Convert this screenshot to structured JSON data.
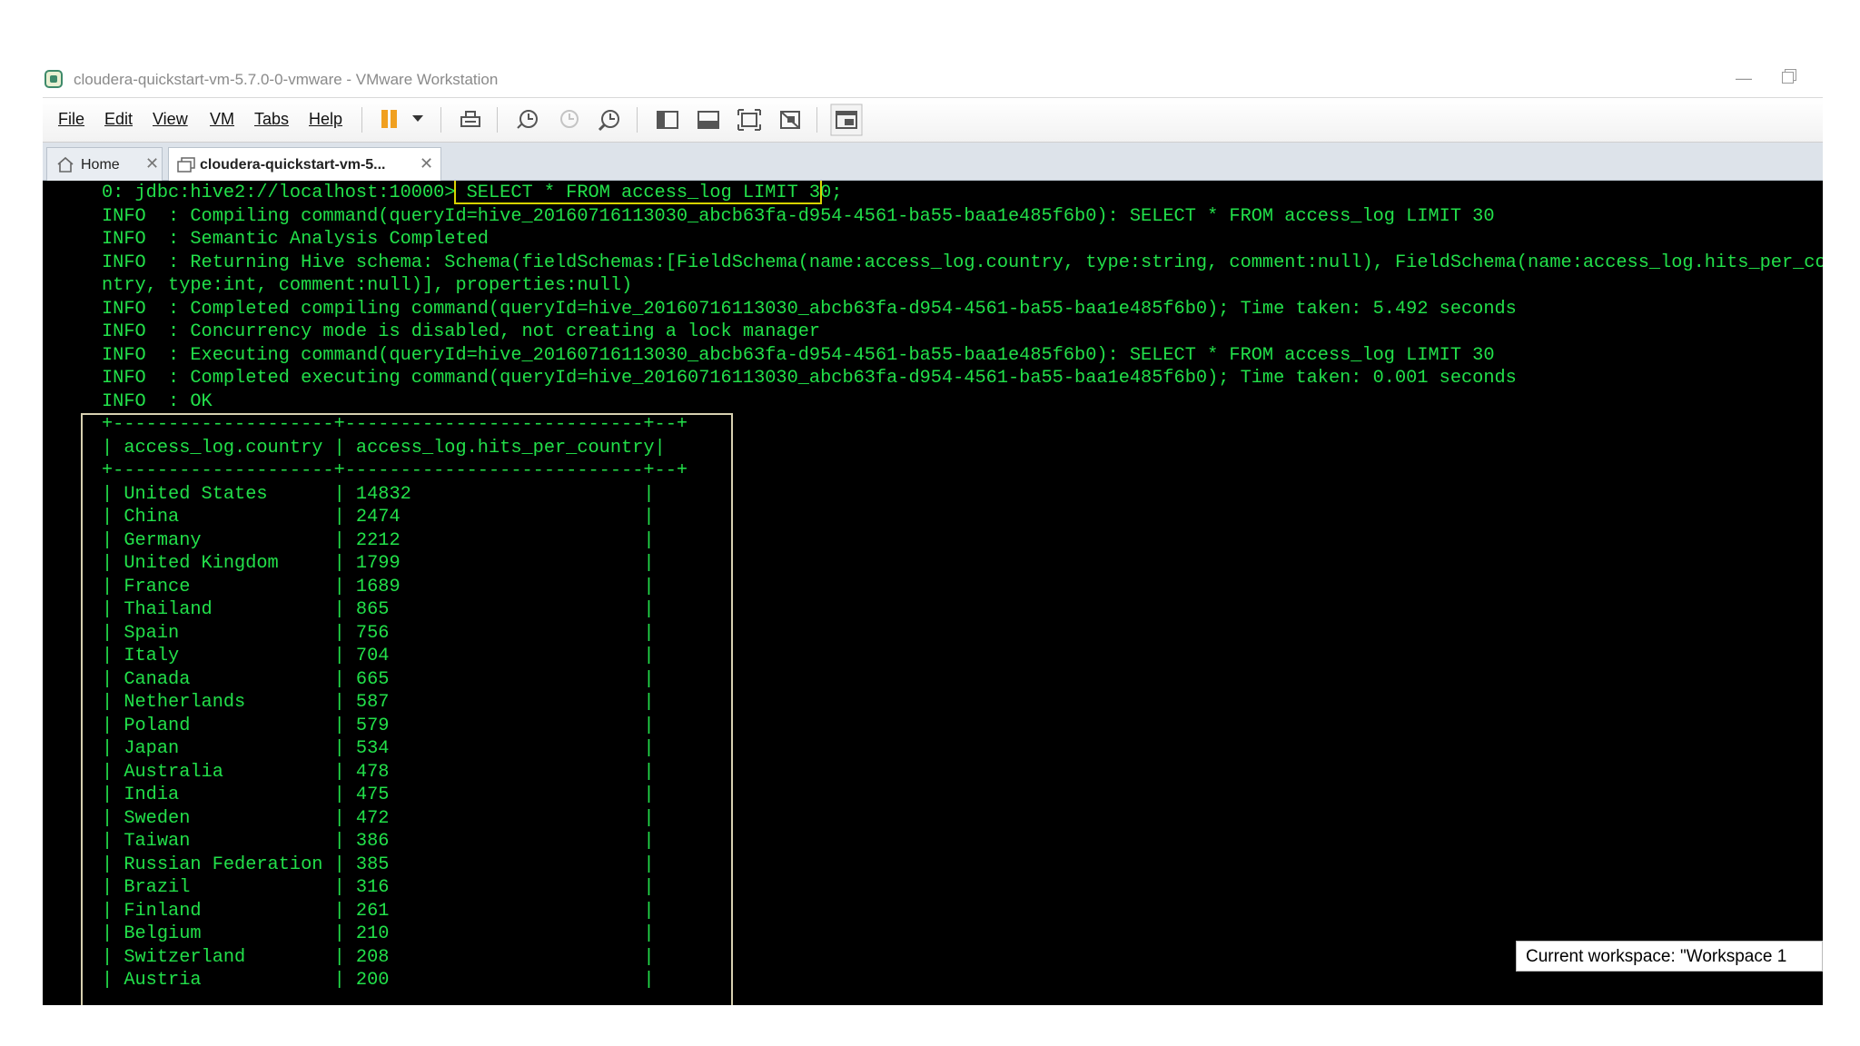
{
  "window": {
    "title": "cloudera-quickstart-vm-5.7.0-0-vmware - VMware Workstation"
  },
  "menu": {
    "items": [
      "File",
      "Edit",
      "View",
      "VM",
      "Tabs",
      "Help"
    ]
  },
  "tabs": [
    {
      "label": "Home"
    },
    {
      "label": "cloudera-quickstart-vm-5..."
    }
  ],
  "console": {
    "prompt": "0: jdbc:hive2://localhost:10000>",
    "command": "SELECT * FROM access_log LIMIT 30;",
    "log_lines": [
      "INFO  : Compiling command(queryId=hive_20160716113030_abcb63fa-d954-4561-ba55-baa1e485f6b0): SELECT * FROM access_log LIMIT 30",
      "INFO  : Semantic Analysis Completed",
      "INFO  : Returning Hive schema: Schema(fieldSchemas:[FieldSchema(name:access_log.country, type:string, comment:null), FieldSchema(name:access_log.hits_per_cou",
      "ntry, type:int, comment:null)], properties:null)",
      "INFO  : Completed compiling command(queryId=hive_20160716113030_abcb63fa-d954-4561-ba55-baa1e485f6b0); Time taken: 5.492 seconds",
      "INFO  : Concurrency mode is disabled, not creating a lock manager",
      "INFO  : Executing command(queryId=hive_20160716113030_abcb63fa-d954-4561-ba55-baa1e485f6b0): SELECT * FROM access_log LIMIT 30",
      "INFO  : Completed executing command(queryId=hive_20160716113030_abcb63fa-d954-4561-ba55-baa1e485f6b0); Time taken: 0.001 seconds",
      "INFO  : OK"
    ],
    "table_border": "+--------------------+---------------------------+--+",
    "columns": [
      "access_log.country",
      "access_log.hits_per_country"
    ],
    "rows": [
      [
        "United States",
        "14832"
      ],
      [
        "China",
        "2474"
      ],
      [
        "Germany",
        "2212"
      ],
      [
        "United Kingdom",
        "1799"
      ],
      [
        "France",
        "1689"
      ],
      [
        "Thailand",
        "865"
      ],
      [
        "Spain",
        "756"
      ],
      [
        "Italy",
        "704"
      ],
      [
        "Canada",
        "665"
      ],
      [
        "Netherlands",
        "587"
      ],
      [
        "Poland",
        "579"
      ],
      [
        "Japan",
        "534"
      ],
      [
        "Australia",
        "478"
      ],
      [
        "India",
        "475"
      ],
      [
        "Sweden",
        "472"
      ],
      [
        "Taiwan",
        "386"
      ],
      [
        "Russian Federation",
        "385"
      ],
      [
        "Brazil",
        "316"
      ],
      [
        "Finland",
        "261"
      ],
      [
        "Belgium",
        "210"
      ],
      [
        "Switzerland",
        "208"
      ],
      [
        "Austria",
        "200"
      ]
    ]
  },
  "tooltip": {
    "text": "Current workspace: \"Workspace 1"
  },
  "colors": {
    "terminal_text": "#22e04a",
    "terminal_bg": "#000000",
    "highlight_box": "#d7d200"
  }
}
